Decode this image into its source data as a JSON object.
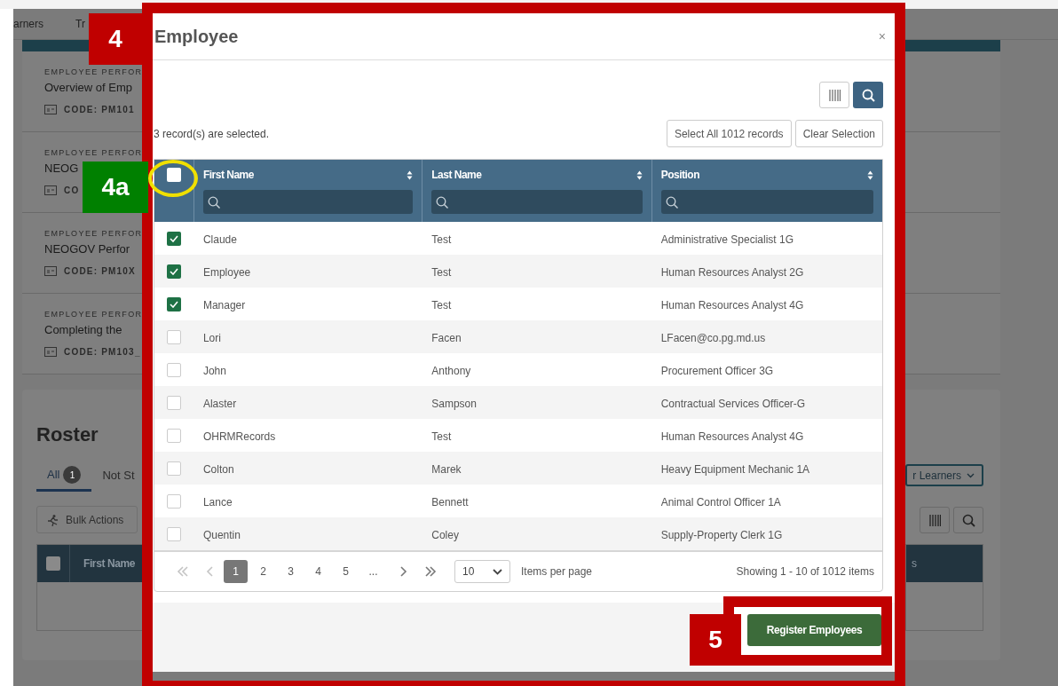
{
  "background_page": {
    "nav": [
      "arners",
      "Tr"
    ],
    "courses": [
      {
        "category": "EMPLOYEE PERFOR",
        "title": "Overview of Emp",
        "code": "CODE: PM101"
      },
      {
        "category": "EMPLOYEE PERFOR",
        "title": "NEOG",
        "code": "CO"
      },
      {
        "category": "EMPLOYEE PERFOR",
        "title": "NEOGOV Perfor",
        "code": "CODE: PM10X"
      },
      {
        "category": "EMPLOYEE PERFOR",
        "title": "Completing the",
        "code": "CODE: PM103_"
      }
    ],
    "roster": {
      "title": "Roster",
      "tabs": [
        {
          "label": "All",
          "count": "1",
          "selected": true
        },
        {
          "label": "Not St",
          "selected": false
        }
      ],
      "bulk_actions": "Bulk Actions",
      "select_all_checked": false,
      "table_column": "First Name",
      "filter_button": "r Learners",
      "table_column_right": "s"
    }
  },
  "modal": {
    "title": "Employee",
    "close": "×",
    "selection_message": "3 record(s) are selected.",
    "select_all_button": "Select All 1012 records",
    "clear_button": "Clear Selection",
    "table": {
      "select_all_checked": false,
      "columns": [
        "First Name",
        "Last Name",
        "Position"
      ],
      "rows": [
        {
          "checked": true,
          "cells": [
            "Claude",
            "Test",
            "Administrative Specialist 1G"
          ]
        },
        {
          "checked": true,
          "cells": [
            "Employee",
            "Test",
            "Human Resources Analyst 2G"
          ]
        },
        {
          "checked": true,
          "cells": [
            "Manager",
            "Test",
            "Human Resources Analyst 4G"
          ]
        },
        {
          "checked": false,
          "cells": [
            "Lori",
            "Facen",
            "LFacen@co.pg.md.us"
          ]
        },
        {
          "checked": false,
          "cells": [
            "John",
            "Anthony",
            "Procurement Officer 3G"
          ]
        },
        {
          "checked": false,
          "cells": [
            "Alaster",
            "Sampson",
            "Contractual Services Officer-G"
          ]
        },
        {
          "checked": false,
          "cells": [
            "OHRMRecords",
            "Test",
            "Human Resources Analyst 4G"
          ]
        },
        {
          "checked": false,
          "cells": [
            "Colton",
            "Marek",
            "Heavy Equipment Mechanic 1A"
          ]
        },
        {
          "checked": false,
          "cells": [
            "Lance",
            "Bennett",
            "Animal Control Officer 1A"
          ]
        },
        {
          "checked": false,
          "cells": [
            "Quentin",
            "Coley",
            "Supply-Property Clerk 1G"
          ]
        }
      ]
    },
    "pager": {
      "pages": [
        {
          "label": "1",
          "selected": true
        },
        {
          "label": "2",
          "selected": false
        },
        {
          "label": "3",
          "selected": false
        },
        {
          "label": "4",
          "selected": false
        },
        {
          "label": "5",
          "selected": false
        },
        {
          "label": "...",
          "selected": false
        }
      ],
      "page_size": "10",
      "page_size_label": "Items per page",
      "summary": "Showing 1 - 10 of 1012 items"
    },
    "register_button": "Register Employees"
  },
  "annotations": [
    {
      "label": "4",
      "color": "#c00000"
    },
    {
      "label": "4a",
      "color": "#008000"
    },
    {
      "label": "5",
      "color": "#c00000"
    }
  ]
}
